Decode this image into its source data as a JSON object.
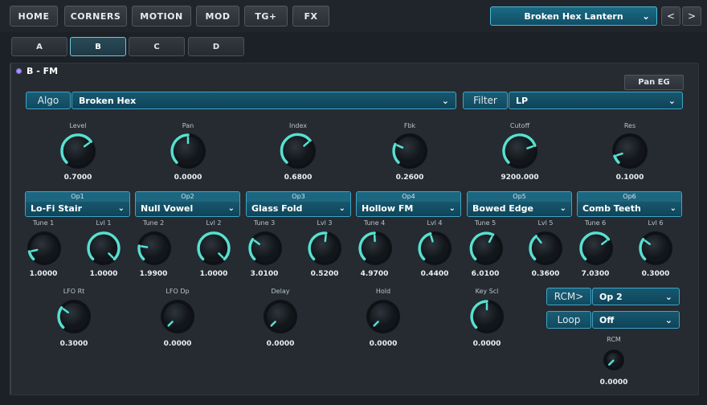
{
  "nav": {
    "home": "HOME",
    "corners": "CORNERS",
    "motion": "MOTION",
    "mod": "MOD",
    "tg": "TG+",
    "fx": "FX"
  },
  "preset": {
    "name": "Broken Hex Lantern",
    "prev": "<",
    "next": ">"
  },
  "tabs": [
    "A",
    "B",
    "C",
    "D"
  ],
  "active_tab": "B",
  "panel": {
    "title": "B - FM",
    "pan_eg": "Pan EG",
    "algo_label": "Algo",
    "algo_value": "Broken Hex",
    "filter_label": "Filter",
    "filter_value": "LP"
  },
  "main_knobs": [
    {
      "label": "Level",
      "value": "0.7000",
      "fraction": 0.7
    },
    {
      "label": "Pan",
      "value": "0.0000",
      "fraction": 0.5
    },
    {
      "label": "Index",
      "value": "0.6800",
      "fraction": 0.68
    },
    {
      "label": "Fbk",
      "value": "0.2600",
      "fraction": 0.26
    },
    {
      "label": "Cutoff",
      "value": "9200.000",
      "fraction": 0.76
    },
    {
      "label": "Res",
      "value": "0.1000",
      "fraction": 0.1
    }
  ],
  "ops": [
    {
      "name": "Op1",
      "value": "Lo-Fi Stair",
      "tune_label": "Tune 1",
      "tune": "1.0000",
      "tune_f": 0.12,
      "lvl_label": "Lvl 1",
      "lvl": "1.0000",
      "lvl_f": 1.0
    },
    {
      "name": "Op2",
      "value": "Null Vowel",
      "tune_label": "Tune 2",
      "tune": "1.9900",
      "tune_f": 0.2,
      "lvl_label": "Lvl 2",
      "lvl": "1.0000",
      "lvl_f": 1.0
    },
    {
      "name": "Op3",
      "value": "Glass Fold",
      "tune_label": "Tune 3",
      "tune": "3.0100",
      "tune_f": 0.3,
      "lvl_label": "Lvl 3",
      "lvl": "0.5200",
      "lvl_f": 0.52
    },
    {
      "name": "Op4",
      "value": "Hollow FM",
      "tune_label": "Tune 4",
      "tune": "4.9700",
      "tune_f": 0.49,
      "lvl_label": "Lvl 4",
      "lvl": "0.4400",
      "lvl_f": 0.44
    },
    {
      "name": "Op5",
      "value": "Bowed Edge",
      "tune_label": "Tune 5",
      "tune": "6.0100",
      "tune_f": 0.6,
      "lvl_label": "Lvl 5",
      "lvl": "0.3600",
      "lvl_f": 0.36
    },
    {
      "name": "Op6",
      "value": "Comb Teeth",
      "tune_label": "Tune 6",
      "tune": "7.0300",
      "tune_f": 0.7,
      "lvl_label": "Lvl 6",
      "lvl": "0.3000",
      "lvl_f": 0.3
    }
  ],
  "bottom_knobs": [
    {
      "label": "LFO Rt",
      "value": "0.3000",
      "fraction": 0.3
    },
    {
      "label": "LFO Dp",
      "value": "0.0000",
      "fraction": 0.0
    },
    {
      "label": "Delay",
      "value": "0.0000",
      "fraction": 0.0
    },
    {
      "label": "Hold",
      "value": "0.0000",
      "fraction": 0.0
    },
    {
      "label": "Key Scl",
      "value": "0.0000",
      "fraction": 0.5
    }
  ],
  "rcm": {
    "rcm_label": "RCM>",
    "rcm_value": "Op 2",
    "loop_label": "Loop",
    "loop_value": "Off",
    "knob_label": "RCM",
    "knob_value": "0.0000",
    "knob_fraction": 0.0
  },
  "colors": {
    "accent": "#57e0d2",
    "track": "#0f1317",
    "knob_body": "#1a1f24"
  }
}
